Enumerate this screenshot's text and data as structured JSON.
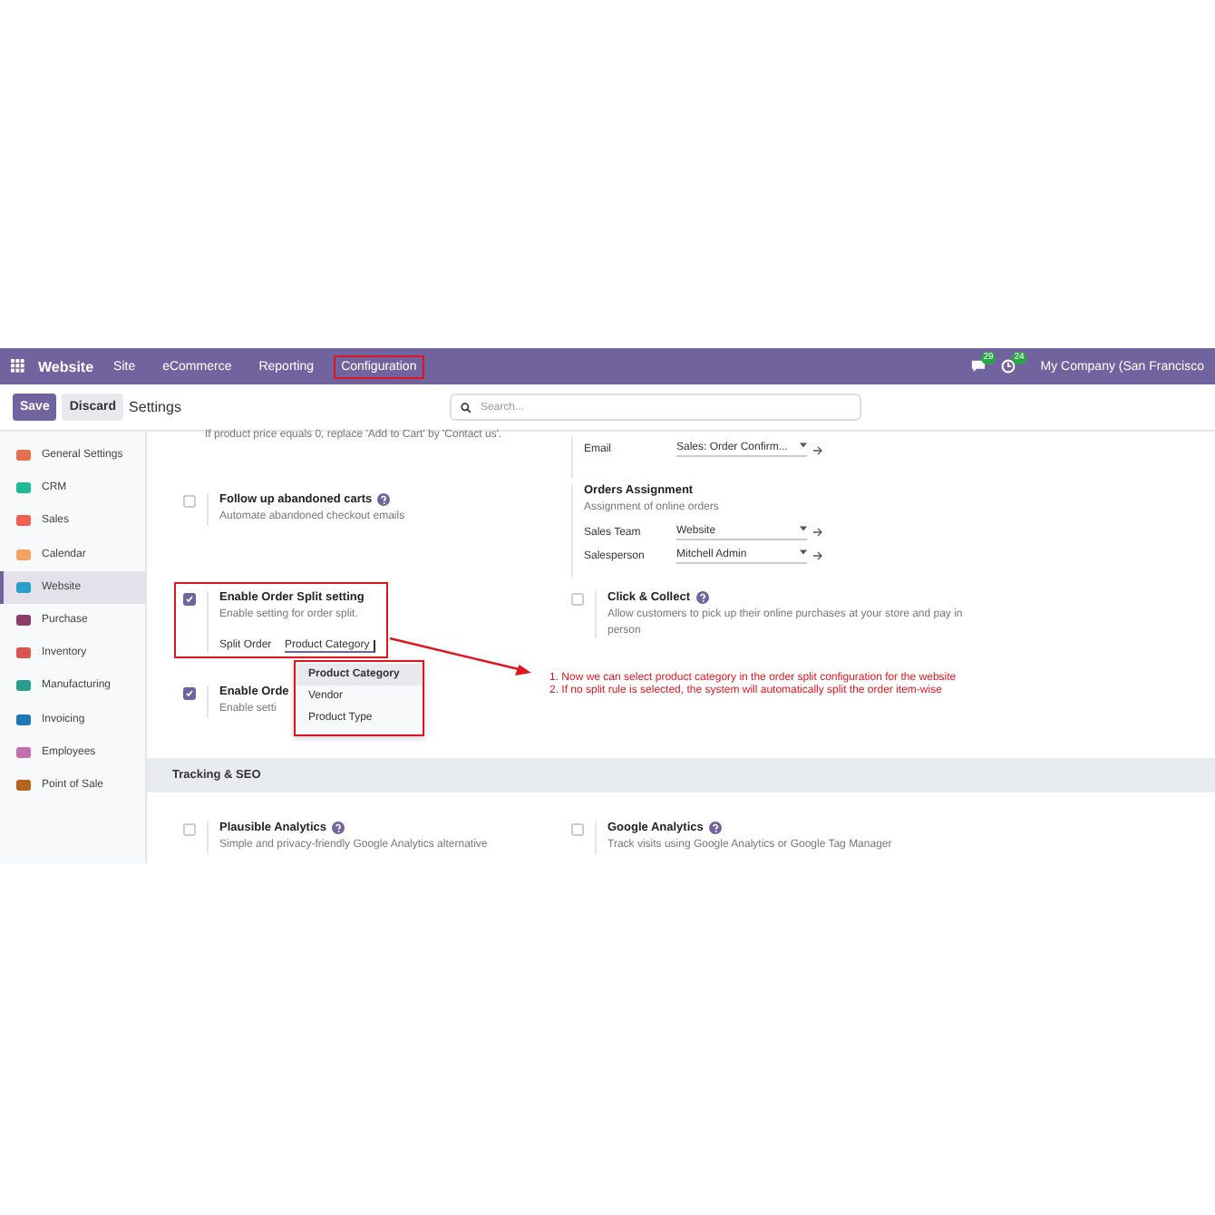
{
  "navbar": {
    "app": "Website",
    "menu": [
      {
        "label": "Site",
        "highlighted": false
      },
      {
        "label": "eCommerce",
        "highlighted": false
      },
      {
        "label": "Reporting",
        "highlighted": false
      },
      {
        "label": "Configuration",
        "highlighted": true
      }
    ],
    "messages_badge": "29",
    "activities_badge": "24",
    "company": "My Company (San Francisco"
  },
  "control_bar": {
    "save": "Save",
    "discard": "Discard",
    "breadcrumb": "Settings",
    "search": {
      "placeholder": "Search..."
    }
  },
  "sidebar": {
    "items": [
      {
        "label": "General Settings",
        "selected": false
      },
      {
        "label": "CRM",
        "selected": false
      },
      {
        "label": "Sales",
        "selected": false
      },
      {
        "label": "Calendar",
        "selected": false
      },
      {
        "label": "Website",
        "selected": true
      },
      {
        "label": "Purchase",
        "selected": false
      },
      {
        "label": "Inventory",
        "selected": false
      },
      {
        "label": "Manufacturing",
        "selected": false
      },
      {
        "label": "Invoicing",
        "selected": false
      },
      {
        "label": "Employees",
        "selected": false
      },
      {
        "label": "Point of Sale",
        "selected": false
      }
    ]
  },
  "general": {
    "rows": [
      {
        "left": {
          "kind": "note",
          "text": "If product price equals 0, replace 'Add to Cart' by 'Contact us'."
        },
        "right": {
          "kind": "fields",
          "fields": [
            {
              "label": "Email",
              "value": "Sales: Order Confirm..."
            }
          ]
        }
      },
      {
        "left": {
          "kind": "option",
          "title": "Follow up abandoned carts",
          "help": true,
          "description": "Automate abandoned checkout emails",
          "checked": false,
          "highlighted": false
        },
        "right": {
          "kind": "group",
          "title": "Orders Assignment",
          "description": "Assignment of online orders",
          "fields": [
            {
              "label": "Sales Team",
              "value": "Website"
            },
            {
              "label": "Salesperson",
              "value": "Mitchell Admin"
            }
          ]
        }
      },
      {
        "left": {
          "kind": "option",
          "title": "Enable Order Split setting",
          "help": false,
          "description": "Enable setting for order split.",
          "checked": true,
          "highlighted": true,
          "split": {
            "label": "Split Order",
            "value": "Product Category",
            "options": [
              {
                "label": "Product Category",
                "selected": true
              },
              {
                "label": "Vendor",
                "selected": false
              },
              {
                "label": "Product Type",
                "selected": false
              }
            ]
          }
        },
        "right": {
          "kind": "option",
          "title": "Click & Collect",
          "help": true,
          "description": "Allow customers to pick up their online purchases at your store and pay in person",
          "checked": false,
          "highlighted": false
        }
      },
      {
        "left": {
          "kind": "option",
          "title": "Enable Orde",
          "help": false,
          "description": "Enable setti",
          "checked": true,
          "highlighted": false
        },
        "right": {
          "kind": "empty"
        }
      }
    ]
  },
  "tracking": {
    "title": "Tracking & SEO",
    "rows": [
      {
        "left": {
          "kind": "option",
          "title": "Plausible Analytics",
          "help": true,
          "description": "Simple and privacy-friendly Google Analytics alternative",
          "checked": false,
          "highlighted": false
        },
        "right": {
          "kind": "option",
          "title": "Google Analytics",
          "help": true,
          "description": "Track visits using Google Analytics or Google Tag Manager",
          "checked": false,
          "highlighted": false
        }
      }
    ]
  },
  "annotation": {
    "lines": [
      "1. Now we can select product category in the order split configuration for the website",
      "2. If no split rule is selected, the system will automatically split the order item-wise"
    ]
  }
}
